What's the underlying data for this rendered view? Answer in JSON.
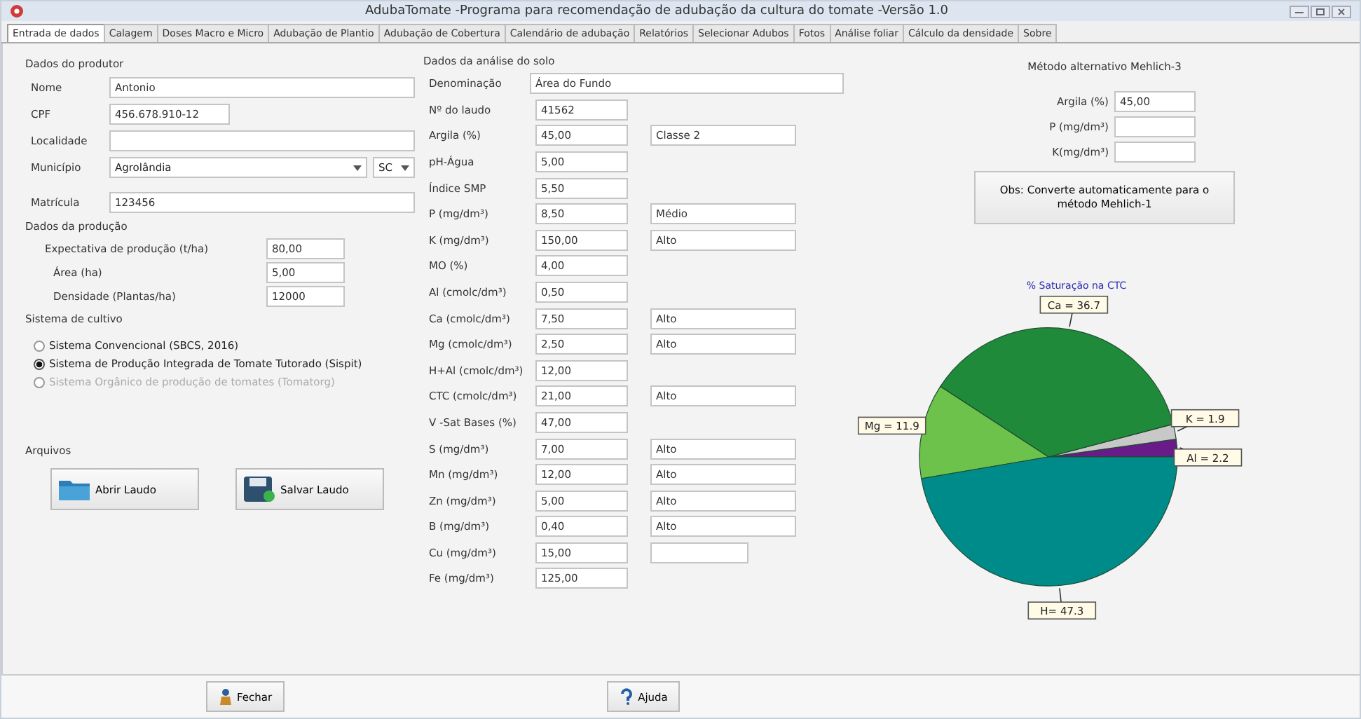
{
  "window": {
    "title": "AdubaTomate -Programa para recomendação de adubação da cultura do tomate -Versão 1.0"
  },
  "tabs": [
    {
      "label": "Entrada de dados",
      "selected": true
    },
    {
      "label": "Calagem",
      "selected": false
    },
    {
      "label": "Doses Macro e Micro",
      "selected": false
    },
    {
      "label": "Adubação de Plantio",
      "selected": false
    },
    {
      "label": "Adubação de Cobertura",
      "selected": false
    },
    {
      "label": "Calendário de adubação",
      "selected": false
    },
    {
      "label": "Relatórios",
      "selected": false
    },
    {
      "label": "Selecionar Adubos",
      "selected": false
    },
    {
      "label": "Fotos",
      "selected": false
    },
    {
      "label": "Análise foliar",
      "selected": false
    },
    {
      "label": "Cálculo da densidade",
      "selected": false
    },
    {
      "label": "Sobre",
      "selected": false
    }
  ],
  "producer": {
    "title": "Dados do produtor",
    "nome": {
      "label": "Nome",
      "value": "Antonio"
    },
    "cpf": {
      "label": "CPF",
      "value": "456.678.910-12"
    },
    "localidade": {
      "label": "Localidade"
    },
    "municipio": {
      "label": "Município",
      "value": "Agrolândia",
      "uf": "SC"
    },
    "matricula": {
      "label": "Matrícula",
      "value": "123456"
    }
  },
  "production": {
    "title": "Dados da produção",
    "fields": [
      {
        "label": "Expectativa de produção (t/ha)",
        "value": "80,00"
      },
      {
        "label": "Área (ha)",
        "value": "5,00"
      },
      {
        "label": "Densidade (Plantas/ha)",
        "value": "12000"
      }
    ]
  },
  "system": {
    "title": "Sistema  de cultivo",
    "options": [
      {
        "label": "Sistema  Convencional (SBCS, 2016)",
        "selected": false,
        "disabled": false
      },
      {
        "label": "Sistema de Produção Integrada de Tomate Tutorado (Sispit)",
        "selected": true,
        "disabled": false
      },
      {
        "label": "Sistema  Orgânico de produção de tomates (Tomatorg)",
        "selected": false,
        "disabled": true
      }
    ]
  },
  "files": {
    "title": "Arquivos",
    "buttons": [
      {
        "label": "Abrir Laudo",
        "kind": "open"
      },
      {
        "label": "Salvar Laudo",
        "kind": "save"
      }
    ]
  },
  "soil": {
    "title": "Dados da análise do solo",
    "denominacao": {
      "label": "Denominação",
      "value": "Área do Fundo"
    },
    "rows": [
      {
        "label": "Nº do laudo",
        "value": "41562"
      },
      {
        "label": "Argila (%)",
        "value": "45,00",
        "class": "Classe 2"
      },
      {
        "label": "pH-Água",
        "value": "5,00"
      },
      {
        "label": "Índice SMP",
        "value": "5,50"
      },
      {
        "label": "P (mg/dm³)",
        "value": "8,50",
        "class": "Médio"
      },
      {
        "label": "K (mg/dm³)",
        "value": "150,00",
        "class": "Alto"
      },
      {
        "label": "MO (%)",
        "value": "4,00"
      },
      {
        "label": "Al (cmolc/dm³)",
        "value": "0,50"
      },
      {
        "label": "Ca (cmolc/dm³)",
        "value": "7,50",
        "class": "Alto"
      },
      {
        "label": "Mg (cmolc/dm³)",
        "value": "2,50",
        "class": "Alto"
      },
      {
        "label": "H+Al (cmolc/dm³)",
        "value": "12,00"
      },
      {
        "label": "CTC (cmolc/dm³)",
        "value": "21,00",
        "class": "Alto"
      },
      {
        "label": "V -Sat Bases (%)",
        "value": "47,00"
      },
      {
        "label": "S (mg/dm³)",
        "value": "7,00",
        "class": "Alto"
      },
      {
        "label": "Mn (mg/dm³)",
        "value": "12,00",
        "class": "Alto"
      },
      {
        "label": "Zn (mg/dm³)",
        "value": "5,00",
        "class": "Alto"
      },
      {
        "label": "B (mg/dm³)",
        "value": "0,40",
        "class": "Alto"
      },
      {
        "label": "Cu (mg/dm³)",
        "value": "15,00",
        "empty_class_field": true
      },
      {
        "label": "Fe (mg/dm³)",
        "value": "125,00"
      }
    ]
  },
  "mehlich3": {
    "title": "Método alternativo Mehlich-3",
    "fields": [
      {
        "label": "Argila (%)",
        "value": "45,00"
      },
      {
        "label": "P (mg/dm³)"
      },
      {
        "label": "K(mg/dm³)"
      }
    ],
    "note_button": "Obs: Converte automaticamente para o método  Mehlich-1"
  },
  "chart_data": {
    "type": "pie",
    "title": "% Saturação na CTC",
    "categories": [
      "Al = 2.2",
      "K = 1.9",
      "Ca = 36.7",
      "Mg = 11.9",
      "H= 47.3"
    ],
    "values": [
      2.2,
      1.9,
      36.7,
      11.9,
      47.3
    ],
    "colors": [
      "#6a1b8a",
      "#c8c8c8",
      "#1f8a3a",
      "#6cc24a",
      "#008b8b"
    ]
  },
  "footer": {
    "buttons": [
      {
        "label": "Fechar",
        "kind": "close"
      },
      {
        "label": "Ajuda",
        "kind": "help"
      }
    ]
  }
}
